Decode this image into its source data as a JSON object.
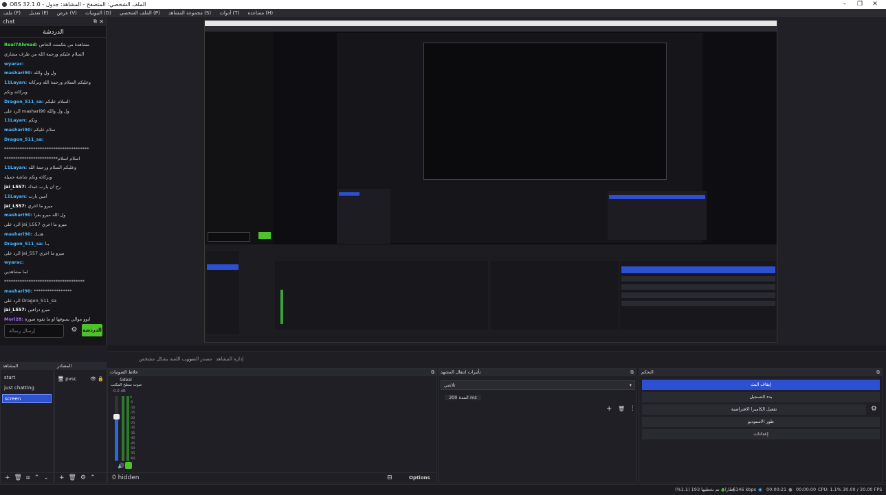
{
  "window": {
    "title": "OBS 32.1.0 - الملف الشخصي: المتصفح - المشاهد: جدول",
    "minimize": "–",
    "maximize": "❐",
    "close": "✕"
  },
  "menu": [
    "ملف (F)",
    "تعديل (E)",
    "عرض (V)",
    "التبويبات (D)",
    "الملف الشخصي (P)",
    "مجموعة المشاهد (S)",
    "أدوات (T)",
    "مساعدة (H)"
  ],
  "chat": {
    "dock_title": "chat",
    "panel_title": "الدردشة",
    "lines": [
      {
        "name": "Real7Ahmad:",
        "text": "مشاهدة من بثكمنت الخاص",
        "color": "#48e64a"
      },
      {
        "name": "",
        "text": "السلام عليكم ورحمة الله من طرف مشاري",
        "color": "#cfcfcf"
      },
      {
        "name": "wyarac:",
        "text": "",
        "color": "#4ab5ff"
      },
      {
        "name": "mashari90:",
        "text": "ول ول والله",
        "color": "#4ab5ff"
      },
      {
        "name": "11Layan:",
        "text": "وعليكم السلام ورحمة الله وبركاته",
        "color": "#4ab5ff"
      },
      {
        "name": "",
        "text": "وبركاته ونكم",
        "color": "#cfcfcf"
      },
      {
        "name": "Dragon_511_sa:",
        "text": "السلام عليكم",
        "color": "#4ab5ff"
      },
      {
        "name": "",
        "text": "الرد على mashari90 ول ول والله",
        "color": "#888"
      },
      {
        "name": "11Layan:",
        "text": "ونكم",
        "color": "#4ab5ff"
      },
      {
        "name": "mashari90:",
        "text": "سلام عليكم",
        "color": "#4ab5ff"
      },
      {
        "name": "Dragon_511_sa:",
        "text": "",
        "color": "#4ab5ff"
      },
      {
        "name": "",
        "text": "**************************************",
        "color": "#cfcfcf"
      },
      {
        "name": "",
        "text": "************************اسلام اسلام",
        "color": "#cfcfcf"
      },
      {
        "name": "11Layan:",
        "text": "وعليكم السلام ورحمة الله",
        "color": "#4ab5ff"
      },
      {
        "name": "",
        "text": "وبركاته ونكم شاشة جميلة",
        "color": "#cfcfcf"
      },
      {
        "name": "jai_L557:",
        "text": "رح ان يارب عبدك",
        "color": "#ffffff"
      },
      {
        "name": "11Layan:",
        "text": "آمين يارب",
        "color": "#4ab5ff"
      },
      {
        "name": "jai_L557:",
        "text": "ميرو ما اخري",
        "color": "#ffffff"
      },
      {
        "name": "mashari90:",
        "text": "ول الله ميرو يقرا",
        "color": "#4ab5ff"
      },
      {
        "name": "",
        "text": "الرد على jai_L557 ميرو ما اخري",
        "color": "#888"
      },
      {
        "name": "mashari90:",
        "text": "هديك",
        "color": "#4ab5ff"
      },
      {
        "name": "Dragon_511_sa:",
        "text": "بـا",
        "color": "#4ab5ff"
      },
      {
        "name": "",
        "text": "الرد على jai_557 ميرو ما اخري",
        "color": "#888"
      },
      {
        "name": "wyarac:",
        "text": "",
        "color": "#4ab5ff"
      },
      {
        "name": "",
        "text": "لما مشاهدين",
        "color": "#cfcfcf"
      },
      {
        "name": "",
        "text": "************************************",
        "color": "#cfcfcf"
      },
      {
        "name": "mashari90:",
        "text": "*****************",
        "color": "#4ab5ff"
      },
      {
        "name": "",
        "text": "الرد على Dragon_511_sa",
        "color": "#888"
      },
      {
        "name": "jai_L557:",
        "text": "ميرو درافين",
        "color": "#ffffff"
      },
      {
        "name": "Mori28:",
        "text": "ايوو موالي يسوقها او ما تقوه صورة",
        "color": "#a970ff"
      }
    ],
    "input_placeholder": "إرسال رسالة",
    "send_button": "الدردشة"
  },
  "transitions_bar": [
    "ترتيب اللعبة بشكل مشخص",
    "مصدر الصور",
    "إدارة المشاهد"
  ],
  "docks": {
    "scenes": {
      "title": "المشاهد",
      "items": [
        "start",
        "just chatting",
        "screen"
      ],
      "selected": 2
    },
    "sources": {
      "title": "المصادر",
      "items": [
        {
          "name": "pvsc",
          "visible": true,
          "locked": true
        }
      ]
    },
    "mixer": {
      "title": "خلاط الصوتيات",
      "channel": "Gdeal",
      "channel_sub": "صوت سطح المكتب",
      "level": "-0.0 dB",
      "ticks": [
        "0",
        "-5",
        "-10",
        "-15",
        "-20",
        "-25",
        "-30",
        "-35",
        "-40",
        "-45",
        "-50",
        "-55",
        "-60"
      ],
      "hidden_label": "0 hidden",
      "options_label": "Options"
    },
    "transitions": {
      "title": "تأثيرات انتقال المشهد",
      "type": "تلاشي",
      "duration_label": "المدة",
      "duration_value": "300 ms"
    },
    "controls": {
      "title": "التحكم",
      "buttons": [
        "إيقاف البث",
        "بدء التسجيل",
        "تفعيل الكاميرا الافتراضية",
        "طور الاستوديو",
        "إعدادات"
      ]
    }
  },
  "status": {
    "frames_dropped": "إطارات تم تخطيها 193 (1.1%)",
    "bitrate": "6146 kbps",
    "live_time": "00:00:21",
    "rec_time": "00:00:00",
    "cpu": "CPU: 1.1%",
    "fps": "30.00 / 30.00 FPS"
  },
  "colors": {
    "accent": "#2d4fd1",
    "green": "#4ec22b",
    "bg": "#1e1e24"
  }
}
